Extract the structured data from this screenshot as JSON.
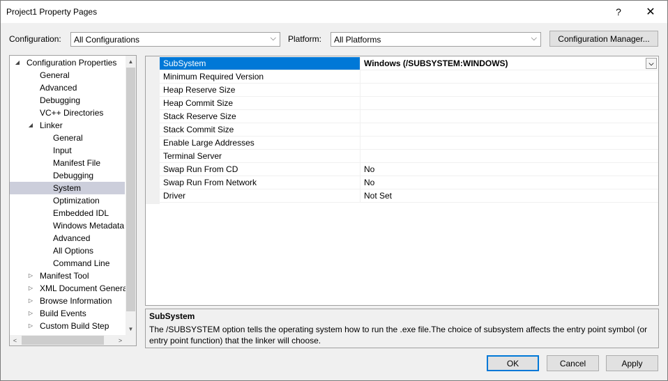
{
  "window": {
    "title": "Project1 Property Pages",
    "help": "?",
    "close": "✕"
  },
  "config_bar": {
    "configuration_label": "Configuration:",
    "configuration_value": "All Configurations",
    "platform_label": "Platform:",
    "platform_value": "All Platforms",
    "config_manager_button": "Configuration Manager..."
  },
  "tree": {
    "items": [
      {
        "label": "Configuration Properties",
        "expander": "expanded"
      },
      {
        "label": "General"
      },
      {
        "label": "Advanced"
      },
      {
        "label": "Debugging"
      },
      {
        "label": "VC++ Directories"
      },
      {
        "label": "Linker",
        "expander": "expanded"
      },
      {
        "label": "General"
      },
      {
        "label": "Input"
      },
      {
        "label": "Manifest File"
      },
      {
        "label": "Debugging"
      },
      {
        "label": "System",
        "selected": true
      },
      {
        "label": "Optimization"
      },
      {
        "label": "Embedded IDL"
      },
      {
        "label": "Windows Metadata"
      },
      {
        "label": "Advanced"
      },
      {
        "label": "All Options"
      },
      {
        "label": "Command Line"
      },
      {
        "label": "Manifest Tool",
        "expander": "collapsed"
      },
      {
        "label": "XML Document Generator",
        "expander": "collapsed"
      },
      {
        "label": "Browse Information",
        "expander": "collapsed"
      },
      {
        "label": "Build Events",
        "expander": "collapsed"
      },
      {
        "label": "Custom Build Step",
        "expander": "collapsed"
      }
    ]
  },
  "grid": {
    "rows": [
      {
        "name": "SubSystem",
        "value": "Windows (/SUBSYSTEM:WINDOWS)",
        "selected": true
      },
      {
        "name": "Minimum Required Version",
        "value": ""
      },
      {
        "name": "Heap Reserve Size",
        "value": ""
      },
      {
        "name": "Heap Commit Size",
        "value": ""
      },
      {
        "name": "Stack Reserve Size",
        "value": ""
      },
      {
        "name": "Stack Commit Size",
        "value": ""
      },
      {
        "name": "Enable Large Addresses",
        "value": ""
      },
      {
        "name": "Terminal Server",
        "value": ""
      },
      {
        "name": "Swap Run From CD",
        "value": "No"
      },
      {
        "name": "Swap Run From Network",
        "value": "No"
      },
      {
        "name": "Driver",
        "value": "Not Set"
      }
    ]
  },
  "description": {
    "title": "SubSystem",
    "text": "The /SUBSYSTEM option tells the operating system how to run the .exe file.The choice of subsystem affects the entry point symbol (or entry point function) that the linker will choose."
  },
  "buttons": {
    "ok": "OK",
    "cancel": "Cancel",
    "apply": "Apply"
  },
  "colors": {
    "selection_blue": "#0078d7",
    "tree_selection": "#cccedb"
  }
}
